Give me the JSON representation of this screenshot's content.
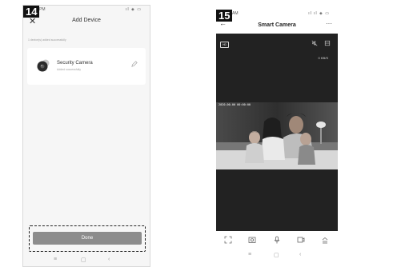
{
  "steps": {
    "left": "14",
    "right": "15"
  },
  "screen1": {
    "status_time": "PM",
    "status_icons": "ıl ◈ ▭",
    "close_glyph": "✕",
    "title": "Add Device",
    "sub_message": "1 device(s) added successfully",
    "device": {
      "name": "Security Camera",
      "status": "Added successfully"
    },
    "done_label": "Done",
    "nav": {
      "menu": "≡",
      "home": "▢",
      "back": "‹"
    }
  },
  "screen2": {
    "status_time": "AM",
    "status_icons": "ıl ıl ◈ ▭",
    "back_glyph": "←",
    "title": "Smart Camera",
    "more_glyph": "···",
    "quality": "HD",
    "rate": "0 KB/S",
    "timestamp": "2020-00-00 00:00:00",
    "nav": {
      "menu": "≡",
      "home": "▢",
      "back": "‹"
    }
  }
}
